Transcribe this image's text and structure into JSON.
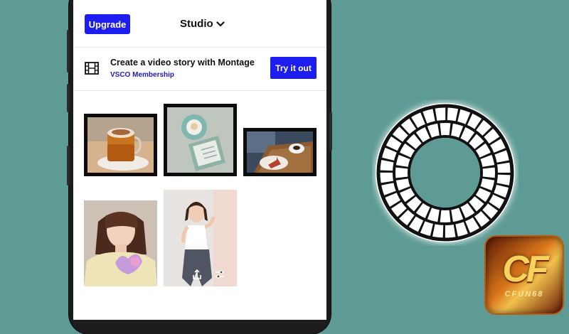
{
  "header": {
    "upgrade_label": "Upgrade",
    "studio_label": "Studio"
  },
  "banner": {
    "title": "Create a video story with Montage",
    "subtitle": "VSCO Membership",
    "cta_label": "Try it out"
  },
  "logo_text": {
    "cf_mark": "CF",
    "cf_name": "CFUN68"
  },
  "colors": {
    "accent": "#1d1df0",
    "background": "#5e9b94",
    "membership_link": "#1d1db8"
  },
  "icons": {
    "studio_menu": "chevron-down-icon",
    "banner": "film-icon",
    "photo_action_share": "share-icon",
    "photo_action_edit": "sliders-icon"
  }
}
